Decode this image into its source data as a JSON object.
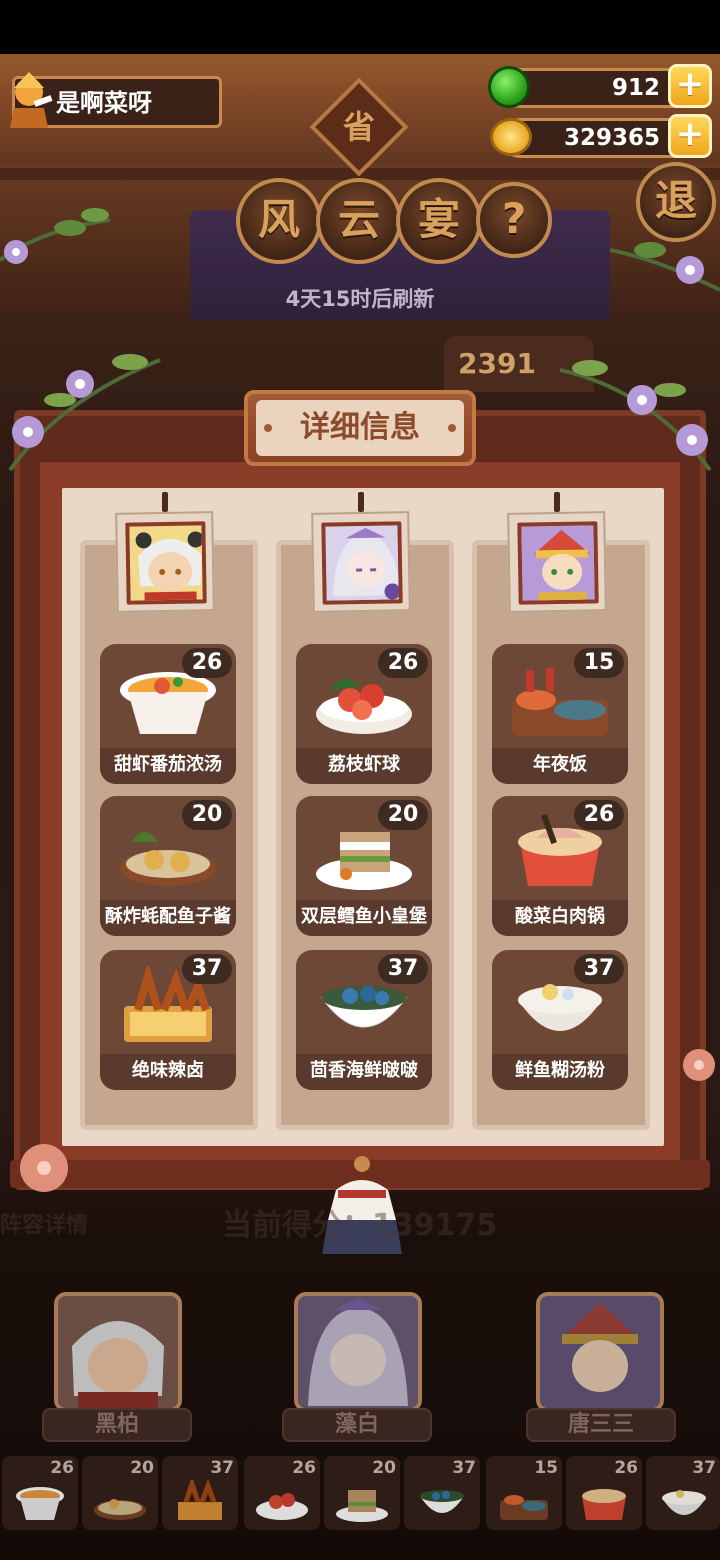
{
  "player": {
    "name": "是啊菜呀"
  },
  "resources": {
    "jade": "912",
    "coins": "329365"
  },
  "event": {
    "chars": [
      "风",
      "云",
      "宴"
    ],
    "help": "?",
    "exit": "退",
    "save_badge": "省",
    "refresh": "4天15时后刷新",
    "score_peek": "2391"
  },
  "panel": {
    "title": "详细信息",
    "columns": [
      {
        "dishes": [
          {
            "name": "甜虾番茄浓汤",
            "count": "26"
          },
          {
            "name": "酥炸蚝配鱼子酱",
            "count": "20"
          },
          {
            "name": "绝味辣卤",
            "count": "37"
          }
        ]
      },
      {
        "dishes": [
          {
            "name": "荔枝虾球",
            "count": "26"
          },
          {
            "name": "双层鳕鱼小皇堡",
            "count": "20"
          },
          {
            "name": "茴香海鲜啵啵",
            "count": "37"
          }
        ]
      },
      {
        "dishes": [
          {
            "name": "年夜饭",
            "count": "15"
          },
          {
            "name": "酸菜白肉锅",
            "count": "26"
          },
          {
            "name": "鲜鱼糊汤粉",
            "count": "37"
          }
        ]
      }
    ]
  },
  "lineup": {
    "label": "阵容详情",
    "score_text": "当前得分：139175",
    "characters": [
      {
        "name": "黑柏"
      },
      {
        "name": "藻白"
      },
      {
        "name": "唐三三"
      }
    ]
  },
  "slots": [
    "26",
    "20",
    "37",
    "26",
    "20",
    "37",
    "15",
    "26",
    "37"
  ]
}
